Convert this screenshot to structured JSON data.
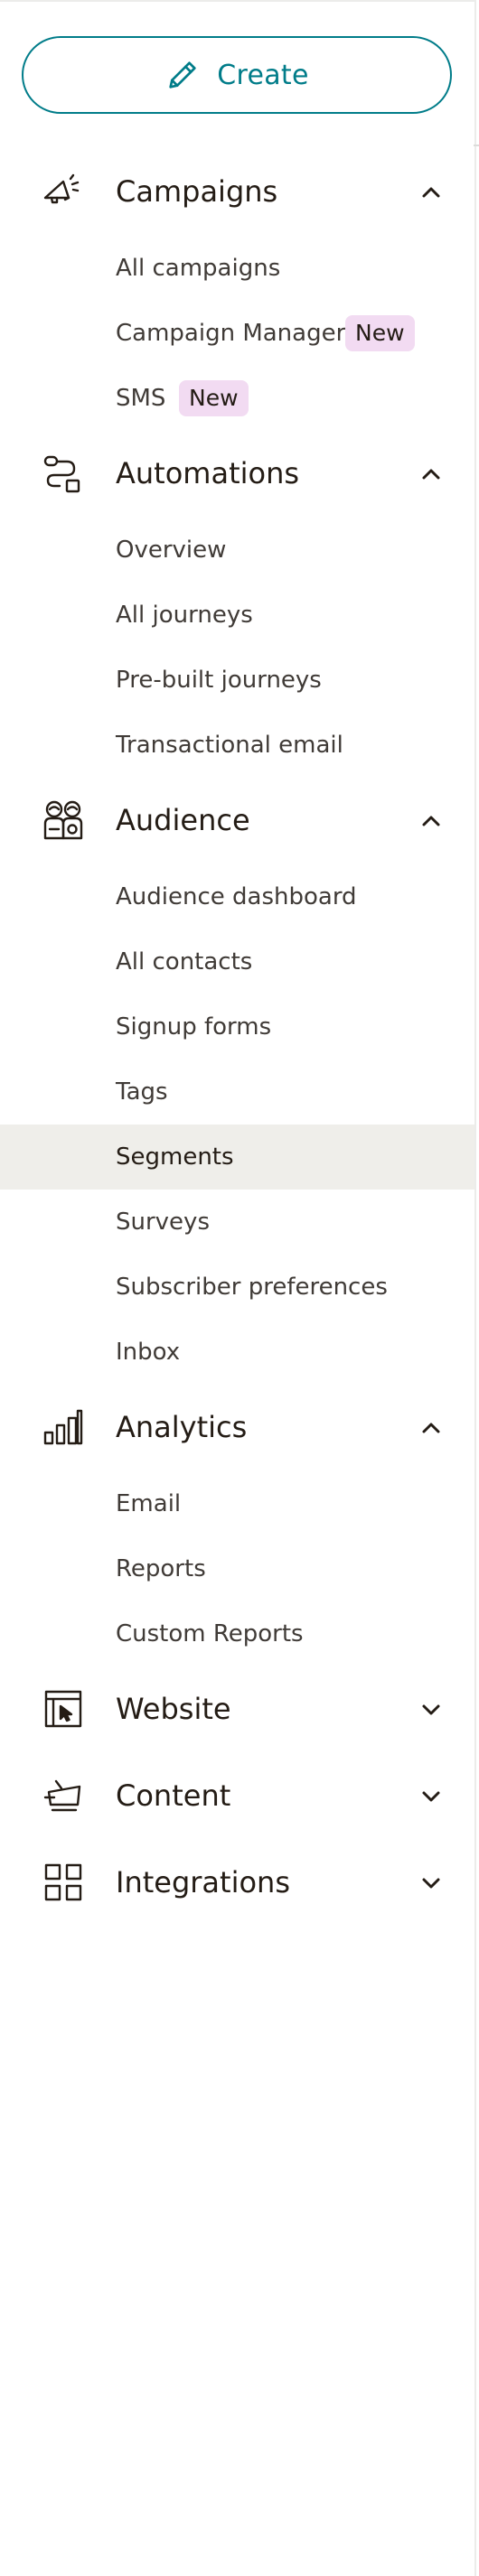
{
  "create": {
    "label": "Create",
    "icon": "pencil-icon",
    "color": "#007c89"
  },
  "theme": {
    "badge_bg": "#f2dbf2",
    "active_bg": "#efeeea",
    "text": "#241c15"
  },
  "sections": {
    "campaigns": {
      "label": "Campaigns",
      "icon": "megaphone-icon",
      "expanded": true,
      "items": [
        {
          "label": "All campaigns"
        },
        {
          "label": "Campaign Manager",
          "badge": "New"
        },
        {
          "label": "SMS",
          "badge": "New"
        }
      ]
    },
    "automations": {
      "label": "Automations",
      "icon": "journey-path-icon",
      "expanded": true,
      "items": [
        {
          "label": "Overview"
        },
        {
          "label": "All journeys"
        },
        {
          "label": "Pre-built journeys"
        },
        {
          "label": "Transactional email"
        }
      ]
    },
    "audience": {
      "label": "Audience",
      "icon": "people-icon",
      "expanded": true,
      "items": [
        {
          "label": "Audience dashboard"
        },
        {
          "label": "All contacts"
        },
        {
          "label": "Signup forms"
        },
        {
          "label": "Tags"
        },
        {
          "label": "Segments",
          "active": true
        },
        {
          "label": "Surveys"
        },
        {
          "label": "Subscriber preferences"
        },
        {
          "label": "Inbox"
        }
      ]
    },
    "analytics": {
      "label": "Analytics",
      "icon": "bar-chart-icon",
      "expanded": true,
      "items": [
        {
          "label": "Email"
        },
        {
          "label": "Reports"
        },
        {
          "label": "Custom Reports"
        }
      ]
    },
    "website": {
      "label": "Website",
      "icon": "website-cursor-icon",
      "expanded": false
    },
    "content": {
      "label": "Content",
      "icon": "content-icon",
      "expanded": false
    },
    "integrations": {
      "label": "Integrations",
      "icon": "grid-icon",
      "expanded": false
    }
  }
}
